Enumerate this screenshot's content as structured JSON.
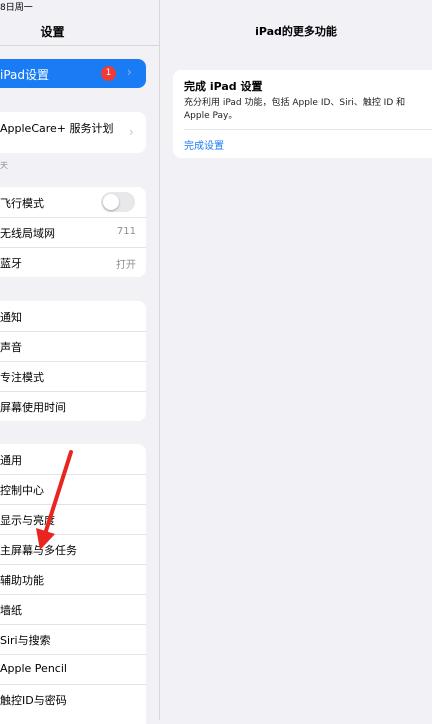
{
  "status": {
    "date": "8日周一"
  },
  "sidebar": {
    "title": "设置",
    "ipad_settings": {
      "label": "iPad设置",
      "badge": "1"
    },
    "applecare": {
      "label": "AppleCare+ 服务计划"
    },
    "section_caption": "天",
    "connectivity": [
      {
        "label": "飞行模式",
        "toggle": "off"
      },
      {
        "label": "无线局域网",
        "value": "711"
      },
      {
        "label": "蓝牙",
        "value": "打开"
      }
    ],
    "notifications": [
      {
        "label": "通知"
      },
      {
        "label": "声音"
      },
      {
        "label": "专注模式"
      },
      {
        "label": "屏幕使用时间"
      }
    ],
    "general": [
      {
        "label": "通用"
      },
      {
        "label": "控制中心"
      },
      {
        "label": "显示与亮度"
      },
      {
        "label": "主屏幕与多任务"
      },
      {
        "label": "辅助功能"
      },
      {
        "label": "墙纸"
      },
      {
        "label": "Siri与搜索"
      },
      {
        "label": "Apple Pencil"
      },
      {
        "label": "触控ID与密码"
      }
    ]
  },
  "detail": {
    "title": "iPad的更多功能",
    "card": {
      "title": "完成 iPad 设置",
      "description": "充分利用 iPad 功能，包括 Apple ID、Siri、触控 ID 和 Apple Pay。",
      "action": "完成设置"
    }
  },
  "colors": {
    "accent": "#1a7cf5",
    "badge": "#ef3b33",
    "annotation_arrow": "#e8251f"
  }
}
